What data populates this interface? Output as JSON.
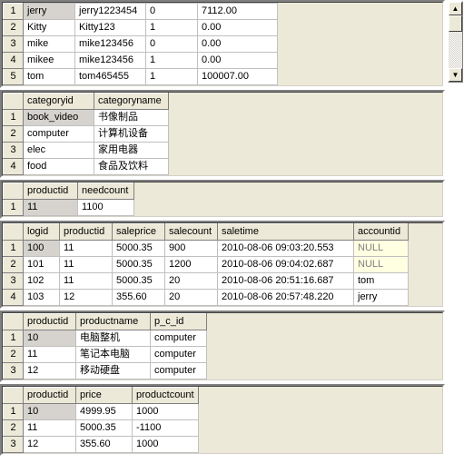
{
  "tables": [
    {
      "id": "t1",
      "show_header": false,
      "columns": [
        "col1",
        "col2",
        "col3",
        "col4"
      ],
      "rows": [
        [
          "jerry",
          "jerry1223454",
          "0",
          "7112.00"
        ],
        [
          "Kitty",
          "Kitty123",
          "1",
          "0.00"
        ],
        [
          "mike",
          "mike123456",
          "0",
          "0.00"
        ],
        [
          "mikee",
          "mike123456",
          "1",
          "0.00"
        ],
        [
          "tom",
          "tom465455",
          "1",
          "100007.00"
        ]
      ],
      "sel_row": 0,
      "sel_col": 0
    },
    {
      "id": "t2",
      "show_header": true,
      "columns": [
        "categoryid",
        "categoryname"
      ],
      "rows": [
        [
          "book_video",
          "书像制品"
        ],
        [
          "computer",
          "计算机设备"
        ],
        [
          "elec",
          "家用电器"
        ],
        [
          "food",
          "食品及饮料"
        ]
      ],
      "sel_row": 0,
      "sel_col": 0
    },
    {
      "id": "t3",
      "show_header": true,
      "columns": [
        "productid",
        "needcount"
      ],
      "rows": [
        [
          "11",
          "1100"
        ]
      ],
      "sel_row": 0,
      "sel_col": 0
    },
    {
      "id": "t4",
      "show_header": true,
      "columns": [
        "logid",
        "productid",
        "saleprice",
        "salecount",
        "saletime",
        "accountid"
      ],
      "rows": [
        [
          "100",
          "11",
          "5000.35",
          "900",
          "2010-08-06 09:03:20.553",
          "NULL"
        ],
        [
          "101",
          "11",
          "5000.35",
          "1200",
          "2010-08-06 09:04:02.687",
          "NULL"
        ],
        [
          "102",
          "11",
          "5000.35",
          "20",
          "2010-08-06 20:51:16.687",
          "tom"
        ],
        [
          "103",
          "12",
          "355.60",
          "20",
          "2010-08-06 20:57:48.220",
          "jerry"
        ]
      ],
      "sel_row": 0,
      "sel_col": 0,
      "null_cells": [
        [
          0,
          5
        ],
        [
          1,
          5
        ]
      ]
    },
    {
      "id": "t5",
      "show_header": true,
      "columns": [
        "productid",
        "productname",
        "p_c_id"
      ],
      "rows": [
        [
          "10",
          "电脑整机",
          "computer"
        ],
        [
          "11",
          "笔记本电脑",
          "computer"
        ],
        [
          "12",
          "移动硬盘",
          "computer"
        ]
      ],
      "sel_row": 0,
      "sel_col": 0
    },
    {
      "id": "t6",
      "show_header": true,
      "columns": [
        "productid",
        "price",
        "productcount"
      ],
      "rows": [
        [
          "10",
          "4999.95",
          "1000"
        ],
        [
          "11",
          "5000.35",
          "-1100"
        ],
        [
          "12",
          "355.60",
          "1000"
        ]
      ],
      "sel_row": 0,
      "sel_col": 0
    }
  ],
  "scroll": {
    "up": "▲",
    "down": "▼"
  }
}
